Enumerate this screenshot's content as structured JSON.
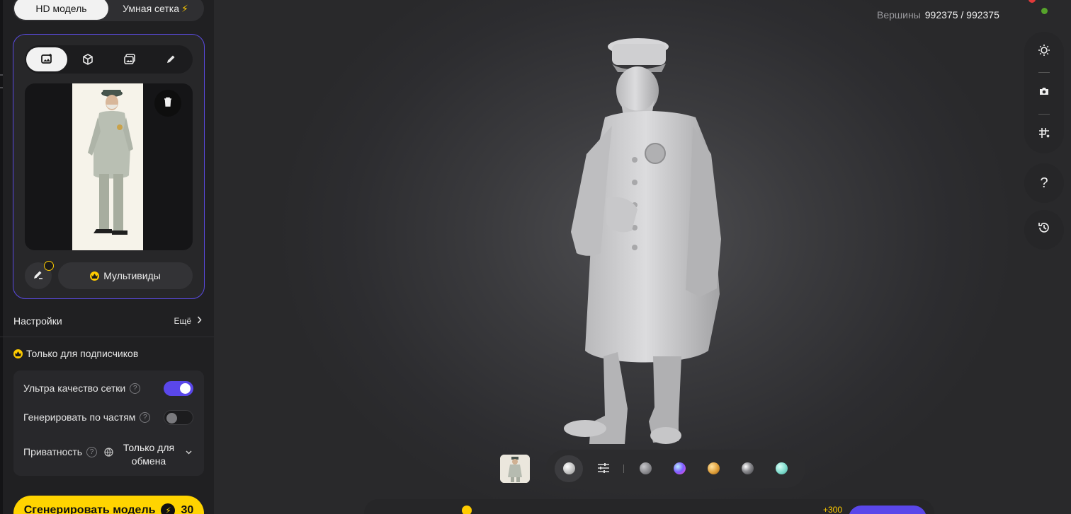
{
  "mode_tabs": {
    "hd": "HD модель",
    "smart": "Умная сетка"
  },
  "icons": {
    "input_tabs": [
      "image-plus-icon",
      "cube-icon",
      "multi-image-icon",
      "pencil-icon"
    ],
    "trash": "trash-icon",
    "edit": "magic-pencil-icon",
    "right_tools": [
      "light-icon",
      "screenshot-icon",
      "grid-icon"
    ],
    "help": "help-icon",
    "history": "history-icon"
  },
  "input": {
    "multiview_label": "Мультивиды"
  },
  "settings": {
    "title": "Настройки",
    "more": "Ещё"
  },
  "subscribers": {
    "title": "Только для подписчиков",
    "ultra_quality": {
      "label": "Ультра качество сетки",
      "on": true
    },
    "by_parts": {
      "label": "Генерировать по частям",
      "on": false
    },
    "privacy": {
      "label": "Приватность",
      "value_line1": "Только для",
      "value_line2": "обмена"
    }
  },
  "generate": {
    "label": "Сгенерировать модель",
    "cost": "30"
  },
  "viewport": {
    "vertices_label": "Вершины",
    "vertices_value": "992375 / 992375",
    "help_symbol": "?"
  },
  "materials": {
    "selected": 0,
    "colors": [
      "#f0f0f0",
      "#8a8a8e",
      "#7d5cff",
      "#e0a03a",
      "#6e6e72",
      "#7fdccd"
    ]
  },
  "bottom": {
    "bonus": "+300"
  },
  "colors": {
    "accent": "#5a47ea",
    "gold": "#ffd400",
    "status_ok": "#56a32b"
  }
}
